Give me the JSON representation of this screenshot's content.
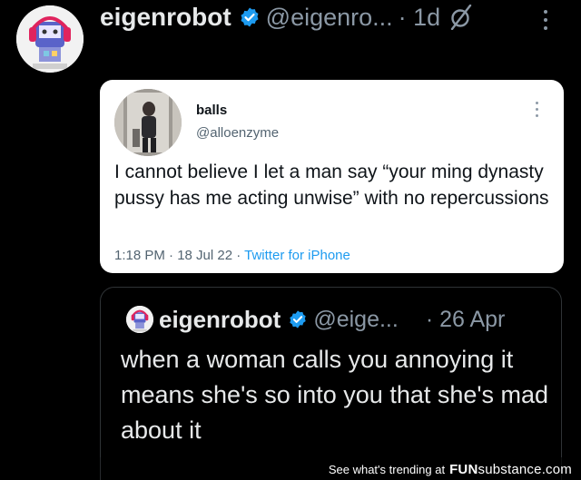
{
  "tweet": {
    "author_name": "eigenrobot",
    "handle": "@eigenro...",
    "time": "· 1d"
  },
  "screenshot_card": {
    "author_name": "balls",
    "handle": "@alloenzyme",
    "text": "I cannot believe I let a man say “your ming dynasty pussy has me acting unwise” with no repercussions",
    "meta": "1:18 PM · 18 Jul 22 · ",
    "source": "Twitter for iPhone"
  },
  "quoted_tweet": {
    "author_name": "eigenrobot",
    "handle": "@eige...",
    "time": "· 26 Apr",
    "text": "when a woman calls you annoying it means she's so into you that she's mad about it"
  },
  "watermark": {
    "text": "See what's trending at",
    "logo_fun": "FUN",
    "logo_substance": "substance",
    "logo_domain": ".com",
    "logo": "FUNsubstance.com"
  },
  "icons": {
    "verified": "verified-badge-icon",
    "grok": "grok-slash-icon",
    "more": "more-vertical-icon"
  },
  "colors": {
    "background": "#000000",
    "text_primary": "#e7e9ea",
    "text_secondary": "#8b98a5",
    "verified_blue": "#1d9bf0",
    "card_background": "#ffffff",
    "link_blue": "#1d9bf0"
  }
}
